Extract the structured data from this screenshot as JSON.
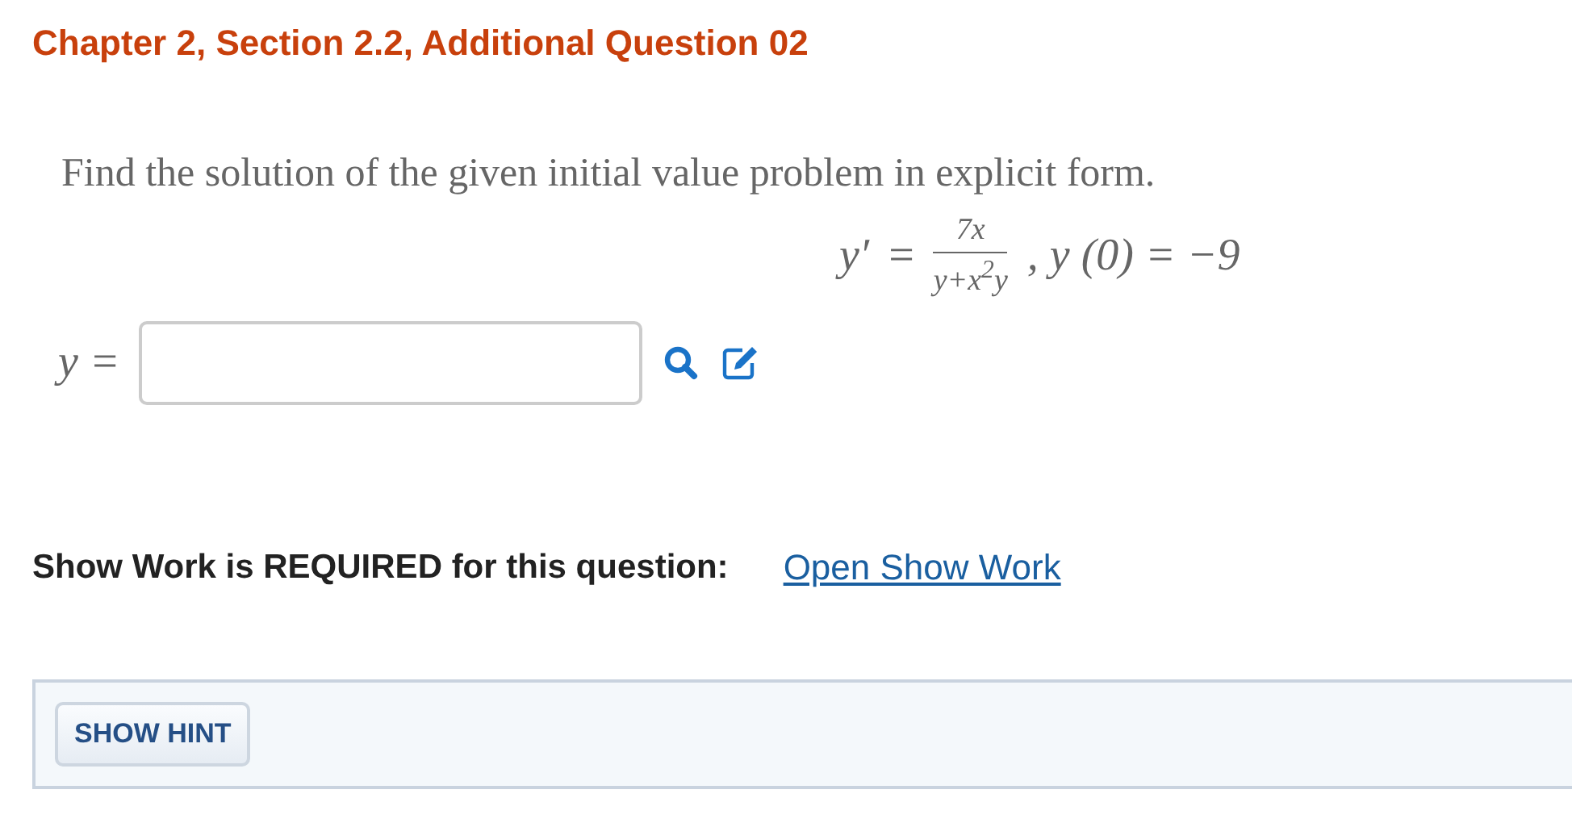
{
  "title": "Chapter 2, Section 2.2, Additional Question 02",
  "question": "Find the solution of the given initial value problem in explicit form.",
  "equation": {
    "lhs": "y′",
    "equals": "=",
    "numerator": "7x",
    "denominator": "y+x$^{2}$y",
    "condition": ", y (0) = −9"
  },
  "answer": {
    "label": "y ="
  },
  "show_work": {
    "text": "Show Work is REQUIRED for this question:",
    "link": "Open Show Work"
  },
  "hint_button": "SHOW HINT"
}
